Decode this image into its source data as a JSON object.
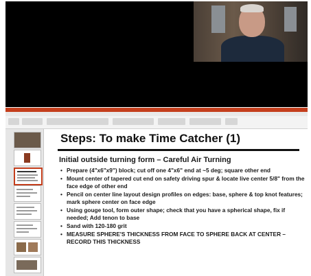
{
  "slide": {
    "title": "Steps: To make Time Catcher (1)",
    "subtitle": "Initial outside turning form – Careful Air Turning",
    "bullets": [
      "Prepare (4\"x6\"x9\") block; cut off one 4\"x6\" end at ~5 deg; square other end",
      "Mount center of tapered cut end on safety driving spur & locate live center 5/8\" from the face edge of other end",
      "Pencil on center line layout design profiles on edges: base, sphere & top knot features; mark sphere center on face edge",
      "Using gouge tool, form outer shape; check that you have a spherical shape, fix if needed; Add tenon to base",
      "Sand with 120-180 grit",
      "MEASURE SPHERE'S THICKNESS FROM FACE TO SPHERE BACK AT CENTER – RECORD THIS THICKNESS"
    ]
  },
  "colors": {
    "accent": "#c43e1c",
    "video_background": "#000000"
  },
  "icons": [
    "webcam-video",
    "slide-thumbnail"
  ]
}
